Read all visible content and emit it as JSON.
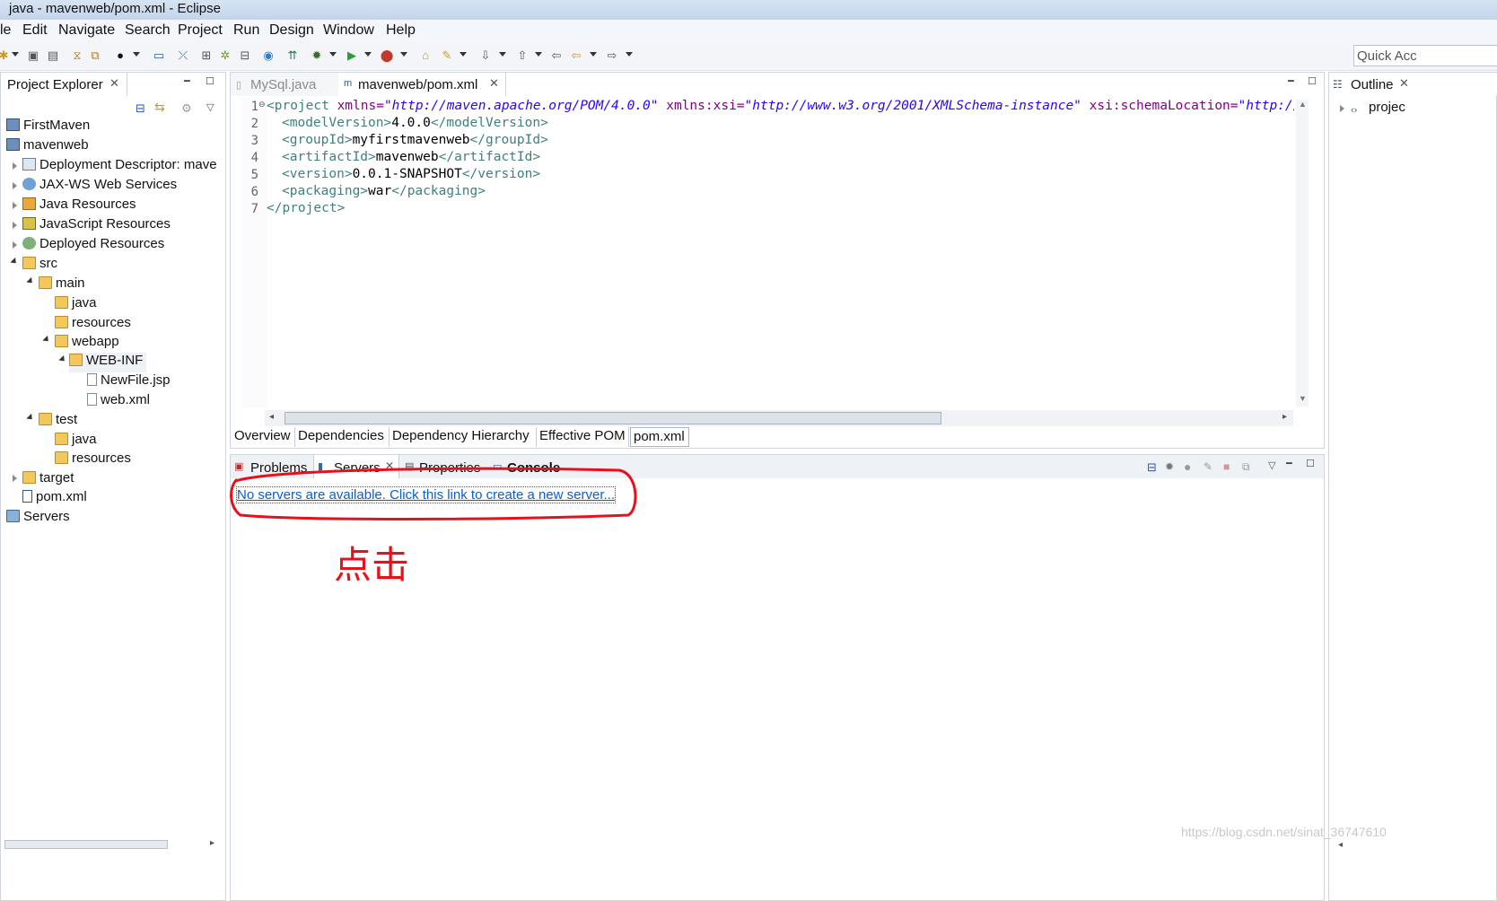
{
  "window": {
    "title": "java - mavenweb/pom.xml - Eclipse"
  },
  "menu": [
    "le",
    "Edit",
    "Navigate",
    "Search",
    "Project",
    "Run",
    "Design",
    "Window",
    "Help"
  ],
  "quick_access": {
    "placeholder": "Quick Acc"
  },
  "project_explorer": {
    "title": "Project Explorer",
    "items": [
      {
        "label": "FirstMaven",
        "icon": "project-icon"
      },
      {
        "label": "mavenweb",
        "icon": "project-icon"
      },
      {
        "label": "Deployment Descriptor: mave",
        "icon": "deployment-descriptor-icon"
      },
      {
        "label": "JAX-WS Web Services",
        "icon": "web-services-icon"
      },
      {
        "label": "Java Resources",
        "icon": "java-resources-icon"
      },
      {
        "label": "JavaScript Resources",
        "icon": "javascript-resources-icon"
      },
      {
        "label": "Deployed Resources",
        "icon": "deployed-resources-icon"
      },
      {
        "label": "src",
        "icon": "folder-icon"
      },
      {
        "label": "main",
        "icon": "folder-icon"
      },
      {
        "label": "java",
        "icon": "folder-icon"
      },
      {
        "label": "resources",
        "icon": "folder-icon"
      },
      {
        "label": "webapp",
        "icon": "folder-icon"
      },
      {
        "label": "WEB-INF",
        "icon": "folder-icon"
      },
      {
        "label": "NewFile.jsp",
        "icon": "jsp-file-icon"
      },
      {
        "label": "web.xml",
        "icon": "xml-file-icon"
      },
      {
        "label": "test",
        "icon": "folder-icon"
      },
      {
        "label": "java",
        "icon": "folder-icon"
      },
      {
        "label": "resources",
        "icon": "folder-icon"
      },
      {
        "label": "target",
        "icon": "folder-icon"
      },
      {
        "label": "pom.xml",
        "icon": "maven-file-icon"
      },
      {
        "label": "Servers",
        "icon": "servers-icon"
      }
    ]
  },
  "editor": {
    "tabs": [
      {
        "label": "MySql.java",
        "active": false
      },
      {
        "label": "mavenweb/pom.xml",
        "active": true
      }
    ],
    "line_numbers": [
      "1",
      "2",
      "3",
      "4",
      "5",
      "6",
      "7"
    ],
    "code": {
      "l1": {
        "open": "<project",
        "a1": " xmlns=",
        "v1": "\"http://maven.apache.org/POM/4.0.0\"",
        "a2": " xmlns:xsi=",
        "v2": "\"http://www.w3.org/2001/XMLSchema-instance\"",
        "a3": " xsi:schemaLocation=",
        "v3": "\"http://mave"
      },
      "l2": {
        "open": "<modelVersion>",
        "text": "4.0.0",
        "close": "</modelVersion>"
      },
      "l3": {
        "open": "<groupId>",
        "text": "myfirstmavenweb",
        "close": "</groupId>"
      },
      "l4": {
        "open": "<artifactId>",
        "text": "mavenweb",
        "close": "</artifactId>"
      },
      "l5": {
        "open": "<version>",
        "text": "0.0.1-SNAPSHOT",
        "close": "</version>"
      },
      "l6": {
        "open": "<packaging>",
        "text": "war",
        "close": "</packaging>"
      },
      "l7": {
        "close": "</project>"
      }
    },
    "pom_tabs": [
      "Overview",
      "Dependencies",
      "Dependency Hierarchy",
      "Effective POM",
      "pom.xml"
    ],
    "active_pom_tab": "pom.xml"
  },
  "bottom_panel": {
    "tabs": [
      "Problems",
      "Servers",
      "Properties",
      "Console"
    ],
    "active_tab": "Servers",
    "create_server_link": "No servers are available. Click this link to create a new server...",
    "annotation": "点击",
    "annotation_color": "#e8101a"
  },
  "outline": {
    "title": "Outline",
    "items": [
      "projec"
    ]
  },
  "watermark": "https://blog.csdn.net/sinat_36747610"
}
